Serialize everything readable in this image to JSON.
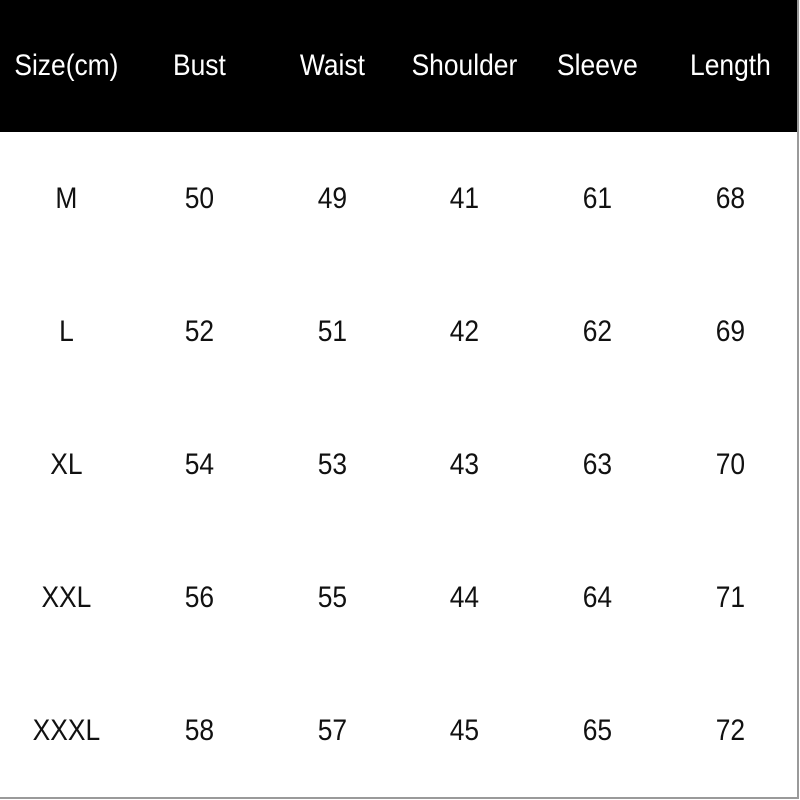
{
  "table": {
    "headers": [
      "Size(cm)",
      "Bust",
      "Waist",
      "Shoulder",
      "Sleeve",
      "Length"
    ],
    "rows": [
      [
        "M",
        "50",
        "49",
        "41",
        "61",
        "68"
      ],
      [
        "L",
        "52",
        "51",
        "42",
        "62",
        "69"
      ],
      [
        "XL",
        "54",
        "53",
        "43",
        "63",
        "70"
      ],
      [
        "XXL",
        "56",
        "55",
        "44",
        "64",
        "71"
      ],
      [
        "XXXL",
        "58",
        "57",
        "45",
        "65",
        "72"
      ]
    ]
  },
  "colors": {
    "header_bg": "#000000",
    "header_text": "#ffffff",
    "body_text": "#111111",
    "border": "#9a9a9a"
  }
}
